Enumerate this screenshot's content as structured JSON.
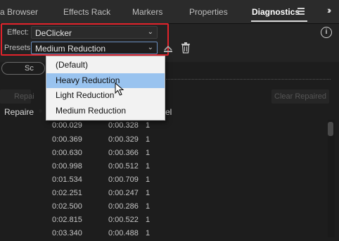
{
  "tabs": [
    {
      "label": "a Browser",
      "active": false
    },
    {
      "label": "Effects Rack",
      "active": false
    },
    {
      "label": "Markers",
      "active": false
    },
    {
      "label": "Properties",
      "active": false
    },
    {
      "label": "Diagnostics",
      "active": true
    }
  ],
  "tab_menu_icon": "hamburger-icon",
  "overflow_icon": "double-chevron-right-icon",
  "effect": {
    "label": "Effect:",
    "value": "DeClicker"
  },
  "presets": {
    "label": "Presets:",
    "value": "Medium Reduction"
  },
  "info_glyph": "i",
  "toolbar": {
    "scan_button_partial": "Sc",
    "repair_partial": "Repai",
    "clear_repaired": "Clear Repaired"
  },
  "menu": {
    "items": [
      {
        "label": "(Default)",
        "selected": false,
        "highlighted": false
      },
      {
        "label": "Heavy Reduction",
        "selected": false,
        "highlighted": true
      },
      {
        "label": "Light Reduction",
        "selected": false,
        "highlighted": false
      },
      {
        "label": "Medium Reduction",
        "selected": true,
        "highlighted": false
      }
    ]
  },
  "table": {
    "headers": [
      "Repaire",
      "el"
    ],
    "rows": [
      [
        "0:00.029",
        "0:00.328",
        "1"
      ],
      [
        "0:00.369",
        "0:00.329",
        "1"
      ],
      [
        "0:00.630",
        "0:00.366",
        "1"
      ],
      [
        "0:00.998",
        "0:00.512",
        "1"
      ],
      [
        "0:01.534",
        "0:00.709",
        "1"
      ],
      [
        "0:02.251",
        "0:00.247",
        "1"
      ],
      [
        "0:02.500",
        "0:00.286",
        "1"
      ],
      [
        "0:02.815",
        "0:00.522",
        "1"
      ],
      [
        "0:03.340",
        "0:00.488",
        "1"
      ]
    ]
  },
  "colors": {
    "accent_red": "#e1232b",
    "menu_highlight": "#99c3ef",
    "background": "#1d1d1d"
  }
}
